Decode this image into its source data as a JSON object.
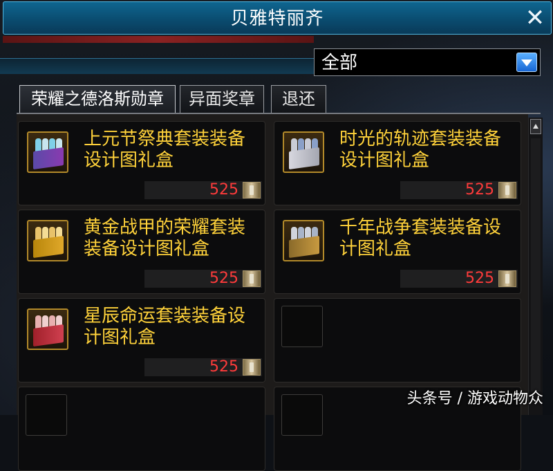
{
  "window": {
    "title": "贝雅特丽齐",
    "close_label": "✕"
  },
  "filter": {
    "selected": "全部"
  },
  "tabs": [
    {
      "label": "荣耀之德洛斯勋章",
      "active": true
    },
    {
      "label": "异面奖章",
      "active": false
    },
    {
      "label": "退还",
      "active": false
    }
  ],
  "items": [
    {
      "name": "上元节祭典套装装备设计图礼盒",
      "price": "525",
      "icon": "festival-gift-box-icon"
    },
    {
      "name": "时光的轨迹套装装备设计图礼盒",
      "price": "525",
      "icon": "time-trail-gift-box-icon"
    },
    {
      "name": "黄金战甲的荣耀套装装备设计图礼盒",
      "price": "525",
      "icon": "golden-armor-gift-box-icon"
    },
    {
      "name": "千年战争套装装备设计图礼盒",
      "price": "525",
      "icon": "millennium-war-gift-box-icon"
    },
    {
      "name": "星辰命运套装装备设计图礼盒",
      "price": "525",
      "icon": "star-fate-gift-box-icon"
    }
  ],
  "currency_icon": "medal-currency-icon",
  "watermark": "头条号 / 游戏动物众"
}
